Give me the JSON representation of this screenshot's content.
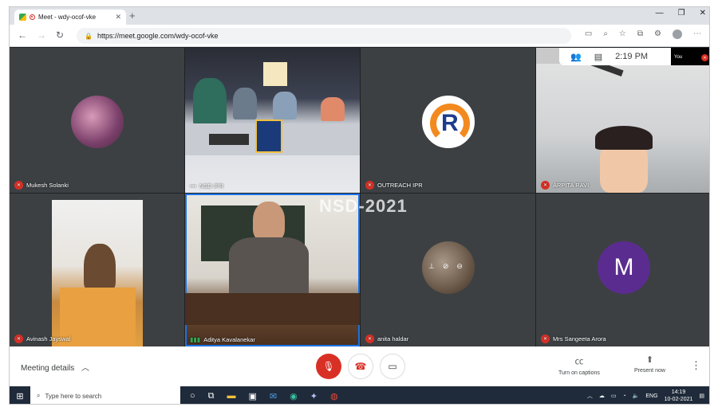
{
  "browser": {
    "tab_title": "Meet - wdy-ocof-vke",
    "tab_close": "✕",
    "new_tab": "+",
    "url": "https://meet.google.com/wdy-ocof-vke",
    "minimize": "—",
    "maximize": "❐",
    "close": "✕"
  },
  "meet": {
    "time": "2:19 PM",
    "self_label": "You",
    "watermark": "NSD-2021",
    "participants": [
      {
        "name": "Mukesh Solanki",
        "muted": true
      },
      {
        "name": "NSD IPR",
        "muted": false
      },
      {
        "name": "OUTREACH IPR",
        "muted": true
      },
      {
        "name": "ARPITA RAVI",
        "muted": true
      },
      {
        "name": "Avinash Jayswal",
        "muted": true
      },
      {
        "name": "Aditya Kavalanekar",
        "muted": false
      },
      {
        "name": "anita haldar",
        "muted": true
      },
      {
        "name": "Mrs Sangeeta Arora",
        "muted": true
      }
    ],
    "avatar_letter": "M",
    "avatar_color": "#5b2c8f"
  },
  "controls": {
    "meeting_details": "Meeting details",
    "turn_on_captions": "Turn on captions",
    "present_now": "Present now"
  },
  "taskbar": {
    "search_placeholder": "Type here to search",
    "lang": "ENG",
    "time": "14:19",
    "date": "10-02-2021"
  },
  "colors": {
    "accent_red": "#d93025",
    "meet_bg": "#202124",
    "tile_bg": "#3c4043"
  }
}
